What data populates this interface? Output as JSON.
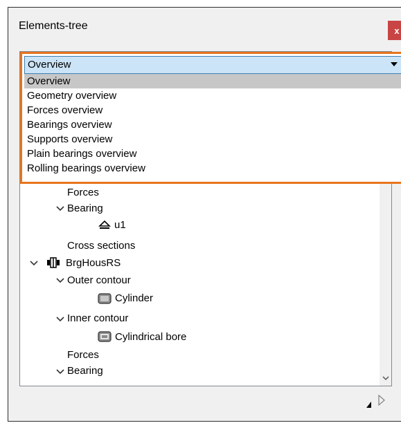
{
  "window": {
    "title": "Elements-tree",
    "close_label": "x"
  },
  "combo": {
    "selected": "Overview",
    "options": [
      "Overview",
      "Geometry overview",
      "Forces overview",
      "Bearings overview",
      "Supports overview",
      "Plain bearings overview",
      "Rolling bearings overview"
    ]
  },
  "tree": {
    "forces_1": "Forces",
    "bearing_1": "Bearing",
    "u1": "u1",
    "cross_sections": "Cross sections",
    "brg_hous": "BrgHousRS",
    "outer_contour": "Outer contour",
    "cylinder": "Cylinder",
    "inner_contour": "Inner contour",
    "cylindrical_bore": "Cylindrical bore",
    "forces_2": "Forces",
    "bearing_2": "Bearing"
  },
  "colors": {
    "highlight": "#e8741d",
    "combo_bg": "#cce4f7",
    "close_bg": "#c94444",
    "selected_item_bg": "#c7c7c7"
  }
}
